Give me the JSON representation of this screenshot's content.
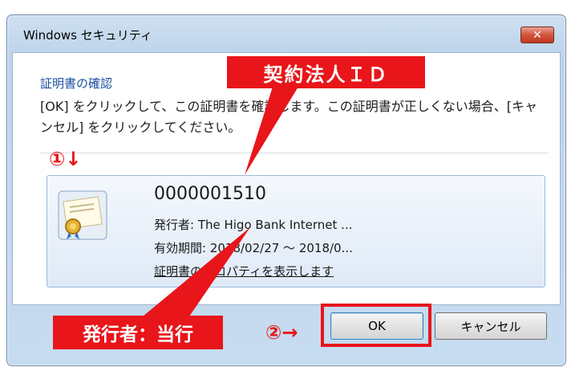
{
  "window": {
    "title": "Windows セキュリティ",
    "close_label": "✕"
  },
  "dialog": {
    "section_title": "証明書の確認",
    "message": "[OK] をクリックして、この証明書を確認します。この証明書が正しくない場合、[キャンセル] をクリックしてください。"
  },
  "certificate": {
    "id": "0000001510",
    "issuer": "発行者: The Higo Bank Internet ...",
    "validity": "有効期間: 2018/02/27 ～ 2018/0...",
    "properties_link": "証明書のプロパティを表示します",
    "icon": "certificate-icon"
  },
  "buttons": {
    "ok": "OK",
    "cancel": "キャンセル"
  },
  "annotations": {
    "callout_id": "契約法人ＩＤ",
    "callout_issuer": "発行者：当行",
    "marker_1": "①↓",
    "marker_2": "②→",
    "color": "#e8151a"
  }
}
